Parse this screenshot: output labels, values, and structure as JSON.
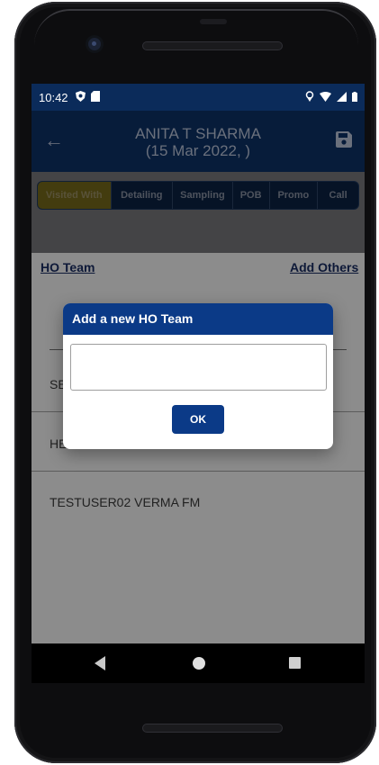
{
  "status_bar": {
    "time": "10:42"
  },
  "appbar": {
    "title_line1": "ANITA T SHARMA",
    "title_line2": "(15 Mar 2022, )",
    "back_icon": "back-arrow-icon",
    "save_icon": "save-icon"
  },
  "tabs": [
    {
      "label": "Visited With",
      "active": true
    },
    {
      "label": "Detailing"
    },
    {
      "label": "Sampling"
    },
    {
      "label": "POB"
    },
    {
      "label": "Promo"
    },
    {
      "label": "Call"
    }
  ],
  "links": {
    "ho_team": "HO Team",
    "add_others": "Add Others"
  },
  "list": {
    "items": [
      "SE",
      "HE",
      "TESTUSER02 VERMA FM"
    ]
  },
  "dialog": {
    "title": "Add a new HO Team",
    "input_value": "",
    "ok_label": "OK"
  },
  "colors": {
    "primary": "#0b3a87",
    "appbar": "#0b2b5a",
    "active_tab": "#7b6d1c"
  }
}
